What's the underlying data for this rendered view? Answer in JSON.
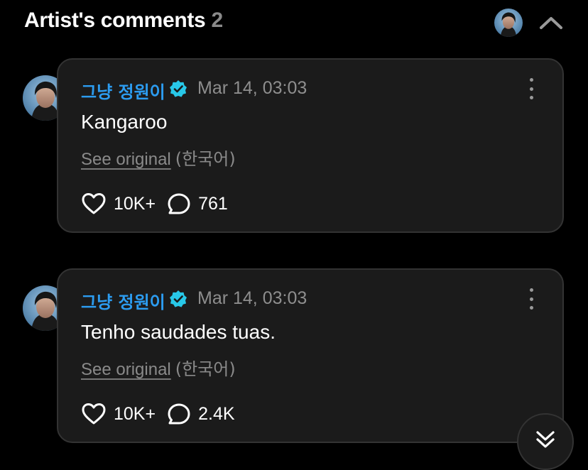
{
  "header": {
    "title": "Artist's comments",
    "count": "2",
    "icons": {
      "avatar": "artist-avatar",
      "collapse": "chevron-up-icon"
    }
  },
  "comments": [
    {
      "author": "그냥 정원이",
      "verified_icon": "verified-badge-icon",
      "timestamp": "Mar 14, 03:03",
      "text": "Kangaroo",
      "see_original": "See original",
      "language": "(한국어)",
      "likes": "10K+",
      "replies": "761"
    },
    {
      "author": "그냥 정원이",
      "verified_icon": "verified-badge-icon",
      "timestamp": "Mar 14, 03:03",
      "text": "Tenho saudades tuas.",
      "see_original": "See original",
      "language": "(한국어)",
      "likes": "10K+",
      "replies": "2.4K"
    }
  ],
  "colors": {
    "background": "#000000",
    "card": "#1b1b1b",
    "card_border": "#333333",
    "author": "#2c9cf0",
    "verified": "#28c8e8",
    "muted": "#8e8e8e"
  }
}
